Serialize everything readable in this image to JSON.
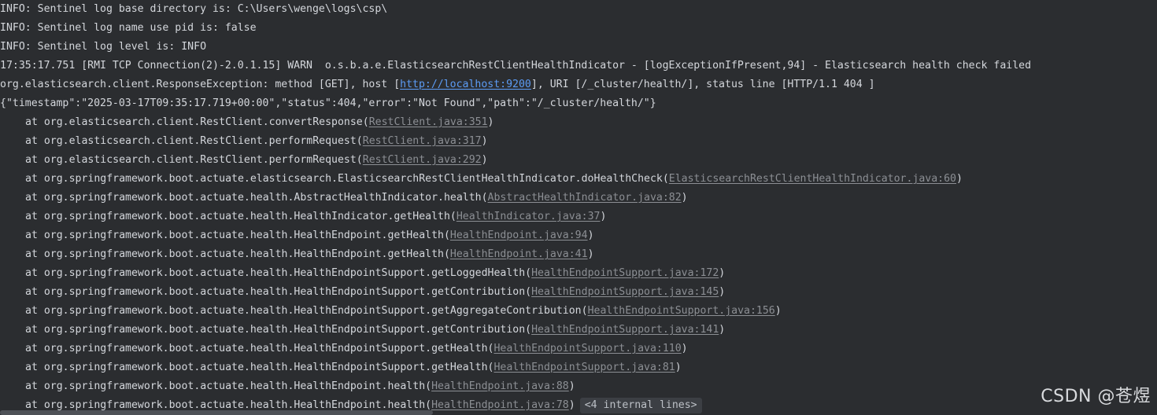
{
  "console": {
    "lines": [
      "INFO: Sentinel log base directory is: C:\\Users\\wenge\\logs\\csp\\",
      "INFO: Sentinel log name use pid is: false",
      "INFO: Sentinel log level is: INFO",
      "17:35:17.751 [RMI TCP Connection(2)-2.0.1.15] WARN  o.s.b.a.e.ElasticsearchRestClientHealthIndicator - [logExceptionIfPresent,94] - Elasticsearch health check failed"
    ],
    "response_line": {
      "prefix": "org.elasticsearch.client.ResponseException: method [GET], host [",
      "url": "http://localhost:9200",
      "suffix": "], URI [/_cluster/health/], status line [HTTP/1.1 404 ]"
    },
    "json_line": "{\"timestamp\":\"2025-03-17T09:35:17.719+00:00\",\"status\":404,\"error\":\"Not Found\",\"path\":\"/_cluster/health/\"}",
    "stack": [
      {
        "method": "at org.elasticsearch.client.RestClient.convertResponse(",
        "source": "RestClient.java:351",
        "close": ")"
      },
      {
        "method": "at org.elasticsearch.client.RestClient.performRequest(",
        "source": "RestClient.java:317",
        "close": ")"
      },
      {
        "method": "at org.elasticsearch.client.RestClient.performRequest(",
        "source": "RestClient.java:292",
        "close": ")"
      },
      {
        "method": "at org.springframework.boot.actuate.elasticsearch.ElasticsearchRestClientHealthIndicator.doHealthCheck(",
        "source": "ElasticsearchRestClientHealthIndicator.java:60",
        "close": ")"
      },
      {
        "method": "at org.springframework.boot.actuate.health.AbstractHealthIndicator.health(",
        "source": "AbstractHealthIndicator.java:82",
        "close": ")"
      },
      {
        "method": "at org.springframework.boot.actuate.health.HealthIndicator.getHealth(",
        "source": "HealthIndicator.java:37",
        "close": ")"
      },
      {
        "method": "at org.springframework.boot.actuate.health.HealthEndpoint.getHealth(",
        "source": "HealthEndpoint.java:94",
        "close": ")"
      },
      {
        "method": "at org.springframework.boot.actuate.health.HealthEndpoint.getHealth(",
        "source": "HealthEndpoint.java:41",
        "close": ")"
      },
      {
        "method": "at org.springframework.boot.actuate.health.HealthEndpointSupport.getLoggedHealth(",
        "source": "HealthEndpointSupport.java:172",
        "close": ")"
      },
      {
        "method": "at org.springframework.boot.actuate.health.HealthEndpointSupport.getContribution(",
        "source": "HealthEndpointSupport.java:145",
        "close": ")"
      },
      {
        "method": "at org.springframework.boot.actuate.health.HealthEndpointSupport.getAggregateContribution(",
        "source": "HealthEndpointSupport.java:156",
        "close": ")"
      },
      {
        "method": "at org.springframework.boot.actuate.health.HealthEndpointSupport.getContribution(",
        "source": "HealthEndpointSupport.java:141",
        "close": ")"
      },
      {
        "method": "at org.springframework.boot.actuate.health.HealthEndpointSupport.getHealth(",
        "source": "HealthEndpointSupport.java:110",
        "close": ")"
      },
      {
        "method": "at org.springframework.boot.actuate.health.HealthEndpointSupport.getHealth(",
        "source": "HealthEndpointSupport.java:81",
        "close": ")"
      },
      {
        "method": "at org.springframework.boot.actuate.health.HealthEndpoint.health(",
        "source": "HealthEndpoint.java:88",
        "close": ")"
      },
      {
        "method": "at org.springframework.boot.actuate.health.HealthEndpoint.health(",
        "source": "HealthEndpoint.java:78",
        "close": ")"
      }
    ],
    "internal_lines_label": "<4 internal lines>"
  },
  "watermark": "CSDN @苍煜",
  "colors": {
    "background": "#2b2d30",
    "text": "#d4d7dc",
    "link": "#5c9cf5",
    "source_link": "#8c8f94"
  }
}
